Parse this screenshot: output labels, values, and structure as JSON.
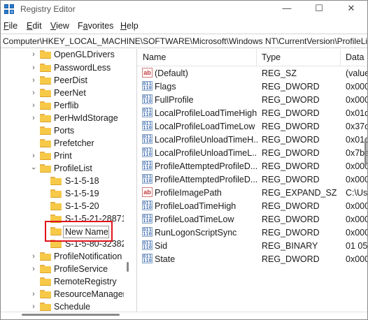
{
  "window": {
    "title": "Registry Editor",
    "controls": {
      "minimize": "—",
      "maximize": "☐",
      "close": "✕"
    }
  },
  "menu": [
    {
      "label": "File",
      "underline": "F",
      "rest": "ile"
    },
    {
      "label": "Edit",
      "underline": "E",
      "rest": "dit"
    },
    {
      "label": "View",
      "underline": "V",
      "rest": "iew"
    },
    {
      "label": "Favorites",
      "underline": "a",
      "prefix": "F",
      "rest": "vorites"
    },
    {
      "label": "Help",
      "underline": "H",
      "rest": "elp"
    }
  ],
  "address": "Computer\\HKEY_LOCAL_MACHINE\\SOFTWARE\\Microsoft\\Windows NT\\CurrentVersion\\ProfileList",
  "tree": {
    "items": [
      {
        "label": "OpenGLDrivers",
        "expanded": false
      },
      {
        "label": "PasswordLess",
        "expanded": false
      },
      {
        "label": "PeerDist",
        "expanded": false
      },
      {
        "label": "PeerNet",
        "expanded": false
      },
      {
        "label": "Perflib",
        "expanded": false
      },
      {
        "label": "PerHwIdStorage",
        "expanded": false
      },
      {
        "label": "Ports",
        "expanded": null
      },
      {
        "label": "Prefetcher",
        "expanded": null
      },
      {
        "label": "Print",
        "expanded": false
      },
      {
        "label": "ProfileList",
        "expanded": true
      },
      {
        "label": "S-1-5-18",
        "expanded": null
      },
      {
        "label": "S-1-5-19",
        "expanded": null
      },
      {
        "label": "S-1-5-20",
        "expanded": null
      },
      {
        "label": "S-1-5-21-28871",
        "expanded": null
      },
      {
        "label": "New Name",
        "expanded": null,
        "editing": true
      },
      {
        "label": "S-1-5-80-32382",
        "expanded": null
      },
      {
        "label": "ProfileNotification",
        "expanded": false
      },
      {
        "label": "ProfileService",
        "expanded": false
      },
      {
        "label": "RemoteRegistry",
        "expanded": null
      },
      {
        "label": "ResourceManager",
        "expanded": false
      },
      {
        "label": "Schedule",
        "expanded": false
      }
    ]
  },
  "list": {
    "columns": {
      "name": "Name",
      "type": "Type",
      "data": "Data"
    },
    "rows": [
      {
        "icon": "string-value-icon",
        "name": "(Default)",
        "type": "REG_SZ",
        "data": "(value"
      },
      {
        "icon": "binary-value-icon",
        "name": "Flags",
        "type": "REG_DWORD",
        "data": "0x000"
      },
      {
        "icon": "binary-value-icon",
        "name": "FullProfile",
        "type": "REG_DWORD",
        "data": "0x000"
      },
      {
        "icon": "binary-value-icon",
        "name": "LocalProfileLoadTimeHigh",
        "type": "REG_DWORD",
        "data": "0x01d"
      },
      {
        "icon": "binary-value-icon",
        "name": "LocalProfileLoadTimeLow",
        "type": "REG_DWORD",
        "data": "0x37c"
      },
      {
        "icon": "binary-value-icon",
        "name": "LocalProfileUnloadTimeH...",
        "type": "REG_DWORD",
        "data": "0x01d"
      },
      {
        "icon": "binary-value-icon",
        "name": "LocalProfileUnloadTimeL...",
        "type": "REG_DWORD",
        "data": "0x7ba"
      },
      {
        "icon": "binary-value-icon",
        "name": "ProfileAttemptedProfileD...",
        "type": "REG_DWORD",
        "data": "0x000"
      },
      {
        "icon": "binary-value-icon",
        "name": "ProfileAttemptedProfileD...",
        "type": "REG_DWORD",
        "data": "0x000"
      },
      {
        "icon": "string-value-icon",
        "name": "ProfileImagePath",
        "type": "REG_EXPAND_SZ",
        "data": "C:\\Use"
      },
      {
        "icon": "binary-value-icon",
        "name": "ProfileLoadTimeHigh",
        "type": "REG_DWORD",
        "data": "0x000"
      },
      {
        "icon": "binary-value-icon",
        "name": "ProfileLoadTimeLow",
        "type": "REG_DWORD",
        "data": "0x000"
      },
      {
        "icon": "binary-value-icon",
        "name": "RunLogonScriptSync",
        "type": "REG_DWORD",
        "data": "0x000"
      },
      {
        "icon": "binary-value-icon",
        "name": "Sid",
        "type": "REG_BINARY",
        "data": "01 05 0"
      },
      {
        "icon": "binary-value-icon",
        "name": "State",
        "type": "REG_DWORD",
        "data": "0x000"
      }
    ]
  },
  "colors": {
    "highlight": "#e0141c",
    "folder": "#f7c948"
  }
}
